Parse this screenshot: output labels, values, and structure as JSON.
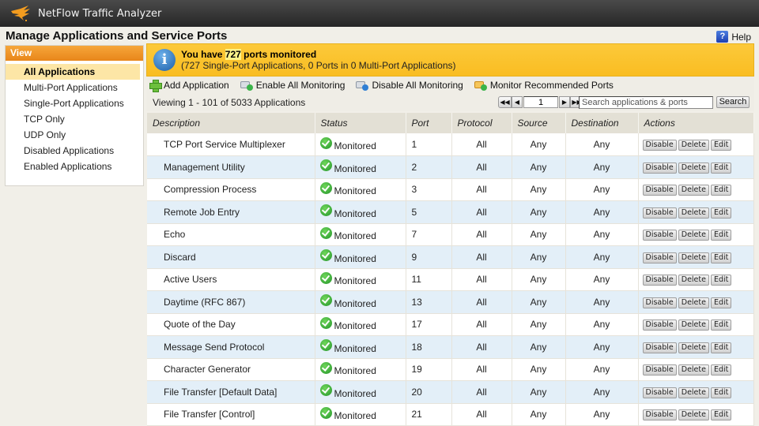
{
  "app": {
    "title": "NetFlow Traffic Analyzer",
    "logo_icon": "solarwinds-logo-icon"
  },
  "page": {
    "title": "Manage Applications and Service Ports",
    "help_label": "Help",
    "help_icon": "question-mark-icon"
  },
  "sidebar": {
    "header": "View",
    "items": [
      {
        "label": "All Applications",
        "active": true
      },
      {
        "label": "Multi-Port Applications",
        "active": false
      },
      {
        "label": "Single-Port Applications",
        "active": false
      },
      {
        "label": "TCP Only",
        "active": false
      },
      {
        "label": "UDP Only",
        "active": false
      },
      {
        "label": "Disabled Applications",
        "active": false
      },
      {
        "label": "Enabled Applications",
        "active": false
      }
    ]
  },
  "banner": {
    "icon": "info-icon",
    "prefix": "You have ",
    "count": "727",
    "suffix": " ports monitored",
    "detail": "(727 Single-Port Applications, 0 Ports in 0 Multi-Port Applications)"
  },
  "toolbar": {
    "add_application": "Add Application",
    "enable_all": "Enable All Monitoring",
    "disable_all": "Disable All Monitoring",
    "monitor_recommended": "Monitor Recommended Ports"
  },
  "pagination": {
    "viewing_text": "Viewing 1 - 101 of 5033 Applications",
    "first": "◀◀",
    "prev": "◀",
    "next": "▶",
    "last": "▶▶",
    "current_page": "1",
    "search_placeholder": "Search applications & ports",
    "search_value": "",
    "search_button": "Search"
  },
  "table": {
    "headers": [
      "Description",
      "Status",
      "Port",
      "Protocol",
      "Source",
      "Destination",
      "Actions"
    ],
    "action_labels": {
      "disable": "Disable",
      "delete": "Delete",
      "edit": "Edit"
    },
    "rows": [
      {
        "description": "TCP Port Service Multiplexer",
        "status": "Monitored",
        "port": "1",
        "protocol": "All",
        "source": "Any",
        "destination": "Any"
      },
      {
        "description": "Management Utility",
        "status": "Monitored",
        "port": "2",
        "protocol": "All",
        "source": "Any",
        "destination": "Any"
      },
      {
        "description": "Compression Process",
        "status": "Monitored",
        "port": "3",
        "protocol": "All",
        "source": "Any",
        "destination": "Any"
      },
      {
        "description": "Remote Job Entry",
        "status": "Monitored",
        "port": "5",
        "protocol": "All",
        "source": "Any",
        "destination": "Any"
      },
      {
        "description": "Echo",
        "status": "Monitored",
        "port": "7",
        "protocol": "All",
        "source": "Any",
        "destination": "Any"
      },
      {
        "description": "Discard",
        "status": "Monitored",
        "port": "9",
        "protocol": "All",
        "source": "Any",
        "destination": "Any"
      },
      {
        "description": "Active Users",
        "status": "Monitored",
        "port": "11",
        "protocol": "All",
        "source": "Any",
        "destination": "Any"
      },
      {
        "description": "Daytime (RFC 867)",
        "status": "Monitored",
        "port": "13",
        "protocol": "All",
        "source": "Any",
        "destination": "Any"
      },
      {
        "description": "Quote of the Day",
        "status": "Monitored",
        "port": "17",
        "protocol": "All",
        "source": "Any",
        "destination": "Any"
      },
      {
        "description": "Message Send Protocol",
        "status": "Monitored",
        "port": "18",
        "protocol": "All",
        "source": "Any",
        "destination": "Any"
      },
      {
        "description": "Character Generator",
        "status": "Monitored",
        "port": "19",
        "protocol": "All",
        "source": "Any",
        "destination": "Any"
      },
      {
        "description": "File Transfer [Default Data]",
        "status": "Monitored",
        "port": "20",
        "protocol": "All",
        "source": "Any",
        "destination": "Any"
      },
      {
        "description": "File Transfer [Control]",
        "status": "Monitored",
        "port": "21",
        "protocol": "All",
        "source": "Any",
        "destination": "Any"
      }
    ]
  },
  "colors": {
    "topbar": "#2e2e2e",
    "sidebar_header": "#ee9224",
    "banner": "#fbc32c",
    "active_item": "#fde6a6",
    "alt_row": "#e3eff8",
    "status_ok": "#2fa83a"
  }
}
